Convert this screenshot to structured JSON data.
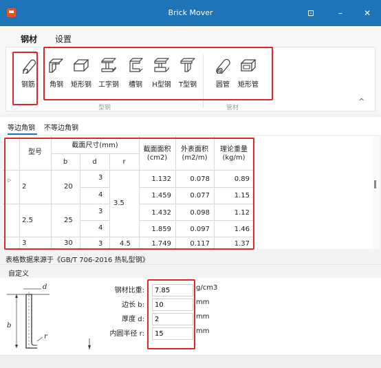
{
  "window": {
    "title": "Brick Mover",
    "restore_glyph": "⊡",
    "minimize_glyph": "–",
    "close_glyph": "✕"
  },
  "ribbon": {
    "tabs": [
      "钢材",
      "设置"
    ],
    "rebar": {
      "label": "钢筋"
    },
    "profiles": {
      "group_label": "型钢",
      "items": [
        {
          "label": "角钢",
          "icon": "angle-steel-icon"
        },
        {
          "label": "矩形钢",
          "icon": "rect-steel-icon"
        },
        {
          "label": "工字钢",
          "icon": "i-beam-icon"
        },
        {
          "label": "槽钢",
          "icon": "channel-steel-icon"
        },
        {
          "label": "H型钢",
          "icon": "h-beam-icon"
        },
        {
          "label": "T型钢",
          "icon": "t-steel-icon"
        }
      ]
    },
    "pipes": {
      "group_label": "管材",
      "items": [
        {
          "label": "圆管",
          "icon": "round-pipe-icon"
        },
        {
          "label": "矩形管",
          "icon": "rect-pipe-icon"
        }
      ]
    },
    "collapse_glyph": "^"
  },
  "subtabs": [
    "等边角钢",
    "不等边角钢"
  ],
  "table": {
    "headers": {
      "model": "型号",
      "section_size": "截面尺寸(mm)",
      "b": "b",
      "d": "d",
      "r": "r",
      "area_l1": "截面面积",
      "area_l2": "(cm2)",
      "surface_l1": "外表面积",
      "surface_l2": "(m2/m)",
      "weight_l1": "理论重量",
      "weight_l2": "(kg/m)"
    },
    "groups": [
      {
        "model": "2",
        "b": "20"
      },
      {
        "model": "2.5",
        "b": "25"
      },
      {
        "model": "3",
        "b": "30"
      }
    ],
    "r_merged": "3.5",
    "rows": [
      {
        "d": "3",
        "area": "1.132",
        "surface": "0.078",
        "weight": "0.89"
      },
      {
        "d": "4",
        "area": "1.459",
        "surface": "0.077",
        "weight": "1.15"
      },
      {
        "d": "3",
        "area": "1.432",
        "surface": "0.098",
        "weight": "1.12"
      },
      {
        "d": "4",
        "area": "1.859",
        "surface": "0.097",
        "weight": "1.46"
      },
      {
        "d": "3",
        "r": "4.5",
        "area": "1.749",
        "surface": "0.117",
        "weight": "1.37"
      }
    ],
    "row_marker": "▷"
  },
  "source_note": "表格数据来源于《GB/T 706-2016 热轧型钢》",
  "custom": {
    "title": "自定义",
    "diagram": {
      "d": "d",
      "b": "b",
      "r": "r"
    },
    "fields": [
      {
        "label": "钢材比重:",
        "value": "7.85",
        "unit": "g/cm3"
      },
      {
        "label": "边长 b:",
        "value": "10",
        "unit": "mm"
      },
      {
        "label": "厚度 d:",
        "value": "2",
        "unit": "mm"
      },
      {
        "label": "内圆半径 r:",
        "value": "15",
        "unit": "mm"
      }
    ]
  },
  "colors": {
    "titlebar": "#1f73b7",
    "highlight": "#e0262b",
    "accent": "#1f73b7"
  }
}
